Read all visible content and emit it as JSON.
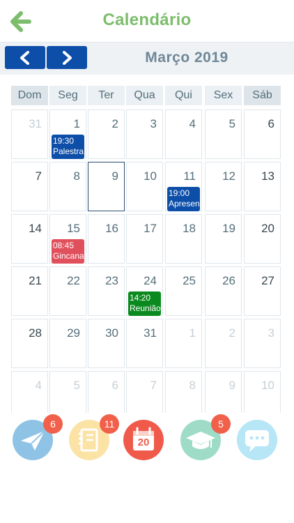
{
  "app": {
    "title": "Calendário"
  },
  "nav": {
    "month_label": "Março 2019"
  },
  "weekdays": [
    "Dom",
    "Seg",
    "Ter",
    "Qua",
    "Qui",
    "Sex",
    "Sáb"
  ],
  "weeks": [
    [
      {
        "d": "31",
        "m": true
      },
      {
        "d": "1"
      },
      {
        "d": "2"
      },
      {
        "d": "3"
      },
      {
        "d": "4"
      },
      {
        "d": "5"
      },
      {
        "d": "6"
      }
    ],
    [
      {
        "d": "7"
      },
      {
        "d": "8"
      },
      {
        "d": "9",
        "today": true
      },
      {
        "d": "10"
      },
      {
        "d": "11"
      },
      {
        "d": "12"
      },
      {
        "d": "13"
      }
    ],
    [
      {
        "d": "14"
      },
      {
        "d": "15"
      },
      {
        "d": "16"
      },
      {
        "d": "17"
      },
      {
        "d": "18"
      },
      {
        "d": "19"
      },
      {
        "d": "20"
      }
    ],
    [
      {
        "d": "21"
      },
      {
        "d": "22"
      },
      {
        "d": "23"
      },
      {
        "d": "24"
      },
      {
        "d": "25"
      },
      {
        "d": "26"
      },
      {
        "d": "27"
      }
    ],
    [
      {
        "d": "28"
      },
      {
        "d": "29"
      },
      {
        "d": "30"
      },
      {
        "d": "31"
      },
      {
        "d": "1",
        "m": true
      },
      {
        "d": "2",
        "m": true
      },
      {
        "d": "3",
        "m": true
      }
    ],
    [
      {
        "d": "4",
        "m": true
      },
      {
        "d": "5",
        "m": true
      },
      {
        "d": "6",
        "m": true
      },
      {
        "d": "7",
        "m": true
      },
      {
        "d": "8",
        "m": true
      },
      {
        "d": "9",
        "m": true
      },
      {
        "d": "10",
        "m": true
      }
    ]
  ],
  "events": [
    {
      "week": 0,
      "day": 1,
      "time": "19:30",
      "title": "Palestra",
      "color": "#0d4ea8"
    },
    {
      "week": 1,
      "day": 4,
      "time": "19:00",
      "title": "Apresen",
      "color": "#0d4ea8"
    },
    {
      "week": 2,
      "day": 1,
      "time": "08:45",
      "title": "Gincana",
      "color": "#e0505c"
    },
    {
      "week": 3,
      "day": 3,
      "time": "14:20",
      "title": "Reunião",
      "color": "#0a8a1e"
    }
  ],
  "tabs": [
    {
      "name": "messages-tab",
      "icon": "paper-plane-icon",
      "badge": "6",
      "color": "#8fc3e6"
    },
    {
      "name": "notebook-tab",
      "icon": "notebook-icon",
      "badge": "11",
      "color": "#fbe3a6"
    },
    {
      "name": "calendar-tab",
      "icon": "calendar-icon",
      "label": "20",
      "color": "#f05a4a"
    },
    {
      "name": "education-tab",
      "icon": "graduation-cap-icon",
      "badge": "5",
      "color": "#9fdcc7"
    },
    {
      "name": "chat-tab",
      "icon": "chat-bubble-icon",
      "color": "#b7e6f6"
    }
  ],
  "colors": {
    "accent": "#7cbd6c",
    "nav": "#0d4ea8",
    "today_border": "#2c4c6e"
  }
}
